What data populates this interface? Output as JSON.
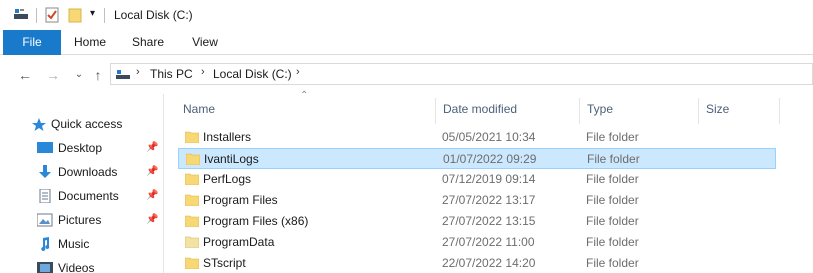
{
  "window": {
    "title": "Local Disk (C:)"
  },
  "ribbon": {
    "tabs": [
      "File",
      "Home",
      "Share",
      "View"
    ]
  },
  "address": {
    "parts": [
      "This PC",
      "Local Disk (C:)"
    ]
  },
  "nav": {
    "items": [
      {
        "label": "Quick access",
        "icon": "star-icon",
        "pinned": false
      },
      {
        "label": "Desktop",
        "icon": "desktop-icon",
        "pinned": true
      },
      {
        "label": "Downloads",
        "icon": "download-icon",
        "pinned": true
      },
      {
        "label": "Documents",
        "icon": "documents-icon",
        "pinned": true
      },
      {
        "label": "Pictures",
        "icon": "pictures-icon",
        "pinned": true
      },
      {
        "label": "Music",
        "icon": "music-icon",
        "pinned": false
      },
      {
        "label": "Videos",
        "icon": "videos-icon",
        "pinned": false
      }
    ]
  },
  "columns": {
    "name": "Name",
    "date": "Date modified",
    "type": "Type",
    "size": "Size"
  },
  "files": [
    {
      "name": "Installers",
      "date": "05/05/2021 10:34",
      "type": "File folder",
      "selected": false
    },
    {
      "name": "IvantiLogs",
      "date": "01/07/2022 09:29",
      "type": "File folder",
      "selected": true
    },
    {
      "name": "PerfLogs",
      "date": "07/12/2019 09:14",
      "type": "File folder",
      "selected": false
    },
    {
      "name": "Program Files",
      "date": "27/07/2022 13:17",
      "type": "File folder",
      "selected": false
    },
    {
      "name": "Program Files (x86)",
      "date": "27/07/2022 13:15",
      "type": "File folder",
      "selected": false
    },
    {
      "name": "ProgramData",
      "date": "27/07/2022 11:00",
      "type": "File folder",
      "selected": false
    },
    {
      "name": "STscript",
      "date": "22/07/2022 14:20",
      "type": "File folder",
      "selected": false
    }
  ],
  "colors": {
    "accent": "#1979ca",
    "selection": "#cce8ff",
    "folder": "#f8d775"
  }
}
